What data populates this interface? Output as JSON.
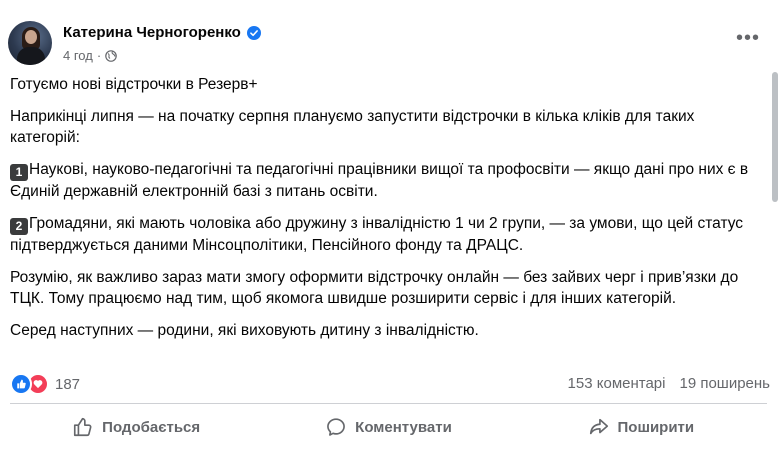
{
  "post": {
    "author": "Катерина Черногоренко",
    "time": "4 год",
    "separator": "·",
    "more_label": "•••",
    "paragraphs": {
      "p1": "Готуємо нові відстрочки в Резерв+",
      "p2": "Наприкінці липня — на початку серпня плануємо запустити відстрочки в кілька кліків для таких категорій:",
      "p3_num": "1",
      "p3": "Наукові, науково-педагогічні та педагогічні працівники вищої та профосвіти — якщо дані про них є в Єдиній державній електронній базі з питань освіти.",
      "p4_num": "2",
      "p4": "Громадяни, які мають чоловіка або дружину з інвалідністю 1 чи 2 групи, — за умови, що цей статус підтверджується даними Мінсоцполітики, Пенсійного фонду та ДРАЦС.",
      "p5": "Розумію, як важливо зараз мати змогу оформити відстрочку онлайн — без зайвих черг і прив’язки до ТЦК. Тому працюємо над тим, щоб якомога швидше розширити сервіс і для інших категорій.",
      "p6": "Серед наступних — родини, які виховують дитину з інвалідністю."
    },
    "reactions_count": "187",
    "comments": "153 коментарі",
    "shares": "19 поширень"
  },
  "actions": {
    "like": "Подобається",
    "comment": "Коментувати",
    "share": "Поширити"
  },
  "colors": {
    "accent": "#1877f2",
    "love": "#f33e58",
    "secondary_text": "#65676b"
  },
  "icons": [
    "verified-badge-icon",
    "globe-icon",
    "more-icon",
    "like-reaction-icon",
    "love-reaction-icon",
    "thumbs-up-icon",
    "comment-icon",
    "share-icon"
  ]
}
